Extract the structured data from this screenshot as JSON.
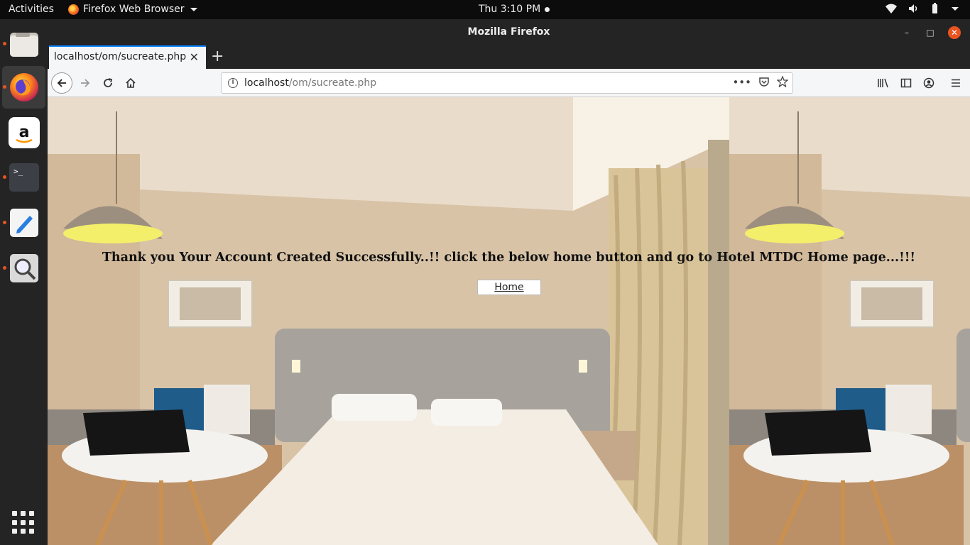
{
  "topbar": {
    "activities": "Activities",
    "app_menu": "Firefox Web Browser",
    "clock": "Thu  3:10 PM"
  },
  "dock": {
    "items": [
      "files-icon",
      "firefox-icon",
      "amazon-icon",
      "terminal-icon",
      "text-editor-icon",
      "image-viewer-icon"
    ]
  },
  "window": {
    "title": "Mozilla Firefox",
    "tab_label": "localhost/om/sucreate.php",
    "url_host": "localhost",
    "url_path": "/om/sucreate.php"
  },
  "page": {
    "message": "Thank you Your Account Created Successfully..!! click the below home button and go to Hotel MTDC Home page...!!!",
    "home_button": "Home"
  },
  "colors": {
    "accent": "#e95420",
    "tab_highlight": "#0a84ff"
  }
}
